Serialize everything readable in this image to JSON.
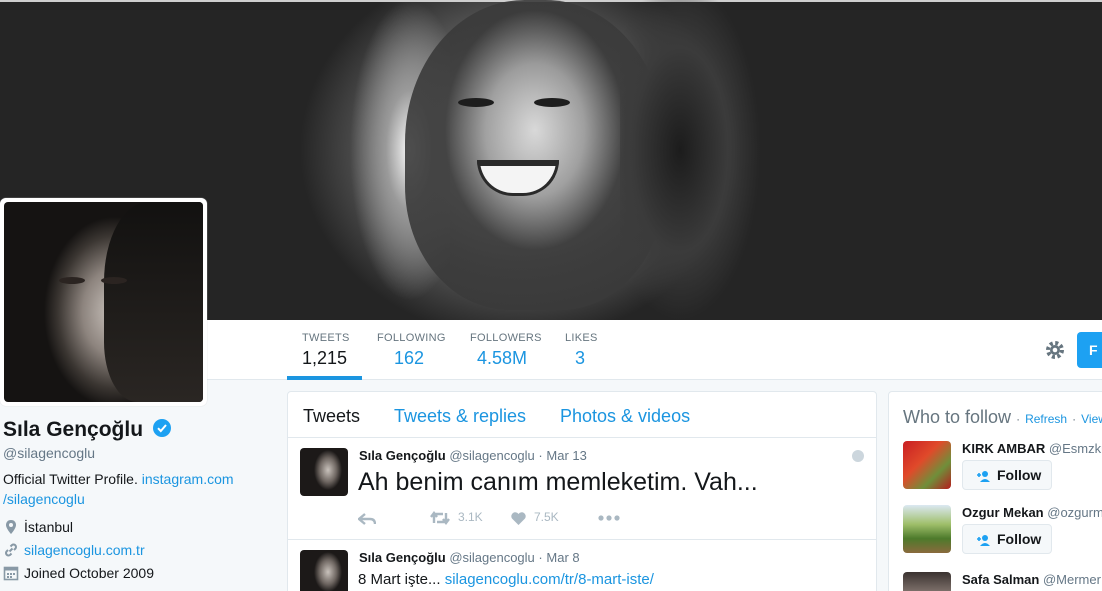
{
  "profile": {
    "name": "Sıla Gençoğlu",
    "handle": "@silagencoglu",
    "bio_text": "Official Twitter Profile. ",
    "bio_link_1": "instagram.com",
    "bio_link_2": "/silagencoglu",
    "location": "İstanbul",
    "website": "silagencoglu.com.tr",
    "joined": "Joined October 2009"
  },
  "nav": {
    "stats": [
      {
        "label": "TWEETS",
        "value": "1,215"
      },
      {
        "label": "FOLLOWING",
        "value": "162"
      },
      {
        "label": "FOLLOWERS",
        "value": "4.58M"
      },
      {
        "label": "LIKES",
        "value": "3"
      }
    ],
    "follow_label": "F"
  },
  "timeline": {
    "tabs": [
      "Tweets",
      "Tweets & replies",
      "Photos & videos"
    ],
    "tweets": [
      {
        "name": "Sıla Gençoğlu",
        "handle": "@silagencoglu",
        "sep": "·",
        "date": "Mar 13",
        "text": "Ah benim canım memleketim. Vah...",
        "retweets": "3.1K",
        "likes": "7.5K"
      },
      {
        "name": "Sıla Gençoğlu",
        "handle": "@silagencoglu",
        "sep": "·",
        "date": "Mar 8",
        "text": "8 Mart işte... ",
        "link": "silagencoglu.com/tr/8-mart-iste/"
      }
    ]
  },
  "who_to_follow": {
    "title": "Who to follow",
    "refresh": "Refresh",
    "dot": "·",
    "view": "View",
    "follow_label": "Follow",
    "users": [
      {
        "name": "KIRK AMBAR",
        "handle": "@Esmzku"
      },
      {
        "name": "Ozgur Mekan",
        "handle": "@ozgurm"
      },
      {
        "name": "Safa Salman",
        "handle": "@Mermer"
      }
    ]
  },
  "colors": {
    "accent": "#1b95e0",
    "follow_button": "#1da1f2",
    "verified": "#1da1f2"
  }
}
